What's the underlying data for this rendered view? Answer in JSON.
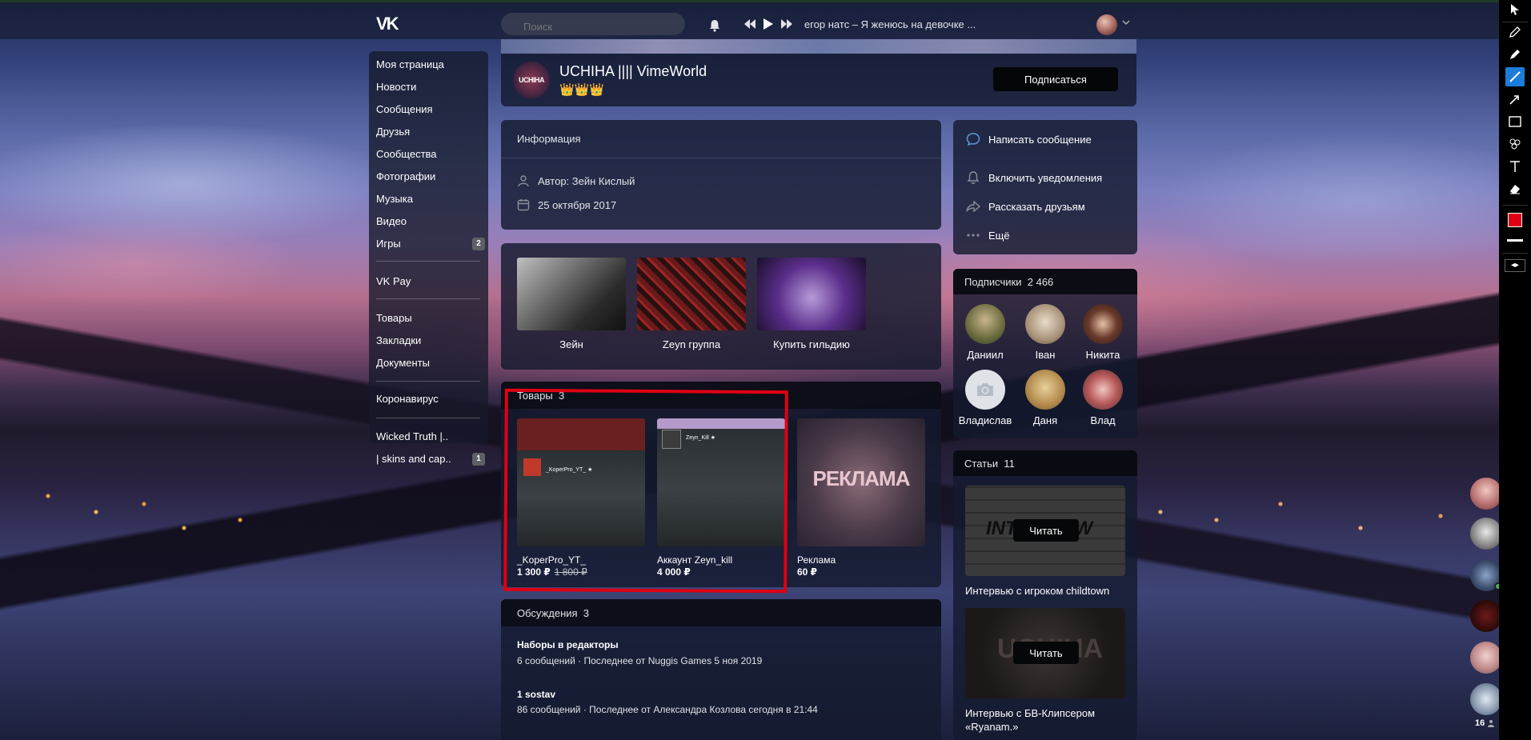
{
  "header": {
    "logo": "VK",
    "search_placeholder": "Поиск",
    "track": "егор натс – Я женюсь на девочке ..."
  },
  "leftnav": {
    "items": [
      {
        "label": "Моя страница"
      },
      {
        "label": "Новости"
      },
      {
        "label": "Сообщения"
      },
      {
        "label": "Друзья"
      },
      {
        "label": "Сообщества"
      },
      {
        "label": "Фотографии"
      },
      {
        "label": "Музыка"
      },
      {
        "label": "Видео"
      },
      {
        "label": "Игры",
        "count": "2"
      },
      {
        "label": "VK Pay"
      },
      {
        "label": "Товары"
      },
      {
        "label": "Закладки"
      },
      {
        "label": "Документы"
      },
      {
        "label": "Коронавирус"
      },
      {
        "label": "Wicked Truth |.."
      },
      {
        "label": "| skins and cap..",
        "count": "1"
      }
    ]
  },
  "group": {
    "avatar_text": "UCHIHA",
    "name": "UCHIHA |||| VimeWorld",
    "crowns": "👑👑👑",
    "subscribe": "Подписаться"
  },
  "info": {
    "title": "Информация",
    "author": "Автор: Зейн Кислый",
    "date": "25 октября 2017"
  },
  "links": [
    {
      "label": "Зейн"
    },
    {
      "label": "Zeyn группа"
    },
    {
      "label": "Купить гильдию"
    }
  ],
  "goods": {
    "title": "Товары",
    "count": "3",
    "items": [
      {
        "name": "_KoperPro_YT_",
        "price": "1 300 ₽",
        "old_price": "1 800 ₽",
        "thumb_text": "_KoperPro_YT_ ★"
      },
      {
        "name": "Аккаунт Zeyn_kill",
        "price": "4 000 ₽",
        "thumb_text": "Zeyn_Kill ★"
      },
      {
        "name": "Реклама",
        "price": "60 ₽",
        "thumb_text": "РЕКЛАМА"
      }
    ]
  },
  "discussions": {
    "title": "Обсуждения",
    "count": "3",
    "topics": [
      {
        "title": "Наборы в редакторы",
        "meta": "6 сообщений  ·  Последнее от Nuggis Games 5 ноя 2019"
      },
      {
        "title": "1 sostav",
        "meta": "86 сообщений  ·  Последнее от Александра Козлова сегодня в 21:44"
      }
    ]
  },
  "actions": [
    {
      "label": "Написать сообщение",
      "icon": "message-icon"
    },
    {
      "label": "Включить уведомления",
      "icon": "bell-icon"
    },
    {
      "label": "Рассказать друзьям",
      "icon": "share-icon"
    },
    {
      "label": "Ещё",
      "icon": "more-icon"
    }
  ],
  "subscribers": {
    "title": "Подписчики",
    "count": "2 466",
    "people": [
      {
        "name": "Даниил"
      },
      {
        "name": "Іван"
      },
      {
        "name": "Никита"
      },
      {
        "name": "Владислав"
      },
      {
        "name": "Даня"
      },
      {
        "name": "Влад"
      }
    ]
  },
  "articles": {
    "title": "Статьи",
    "count": "11",
    "items": [
      {
        "name": "Интервью с игроком childtown",
        "button": "Читать",
        "thumb_text": "INTERVIEW"
      },
      {
        "name": "Интервью с БВ-Клипсером «Ryanam.»",
        "button": "Читать",
        "thumb_text": "UCHIHA"
      }
    ]
  },
  "chat": {
    "online_count": "16"
  },
  "colors": {
    "annotation_red": "#e00012",
    "tool_active": "#1c7cd9",
    "online_green": "#4bb34b"
  }
}
